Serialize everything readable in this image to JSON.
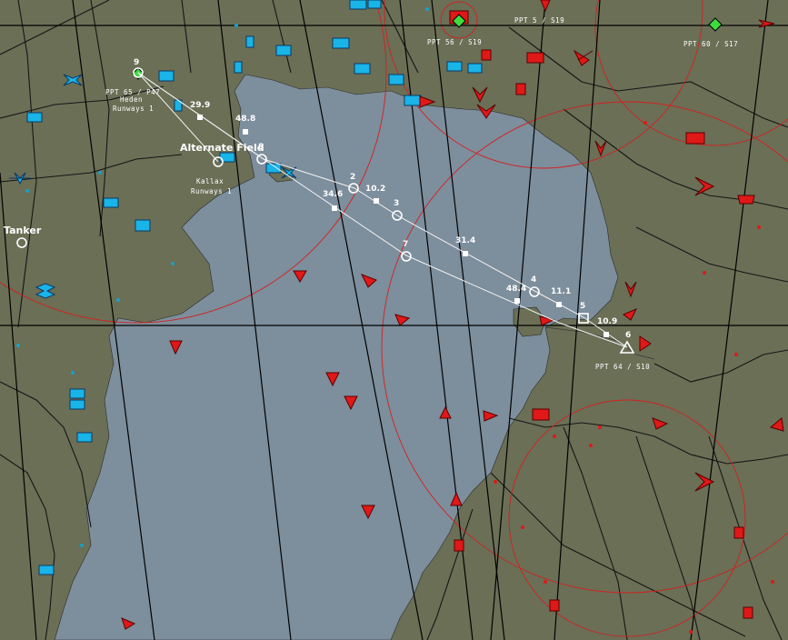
{
  "map": {
    "route_waypoints": [
      "9",
      "8",
      "2",
      "3",
      "7",
      "4",
      "5",
      "6"
    ],
    "leg_distances": [
      "29.9",
      "48.8",
      "10.2",
      "34.6",
      "31.4",
      "48.4",
      "11.1",
      "10.9"
    ],
    "airfields": [
      {
        "name": "Heden",
        "info": "Runways 1"
      },
      {
        "name": "Kallax",
        "info": "Runways 1"
      }
    ],
    "labels": {
      "alternate_field": "Alternate Field",
      "tanker": "Tanker"
    },
    "sam_labels": [
      "PPT 65 / P47",
      "PPT 56 / S19",
      "PPT 5 / S19",
      "PPT 60 / S17",
      "PPT 64 / S10"
    ],
    "colors": {
      "land": "#6a6f56",
      "water": "#7d8e9c",
      "friendly": "#19b4e8",
      "hostile": "#e01818",
      "route": "#ffffff",
      "grid": "#000000"
    }
  }
}
